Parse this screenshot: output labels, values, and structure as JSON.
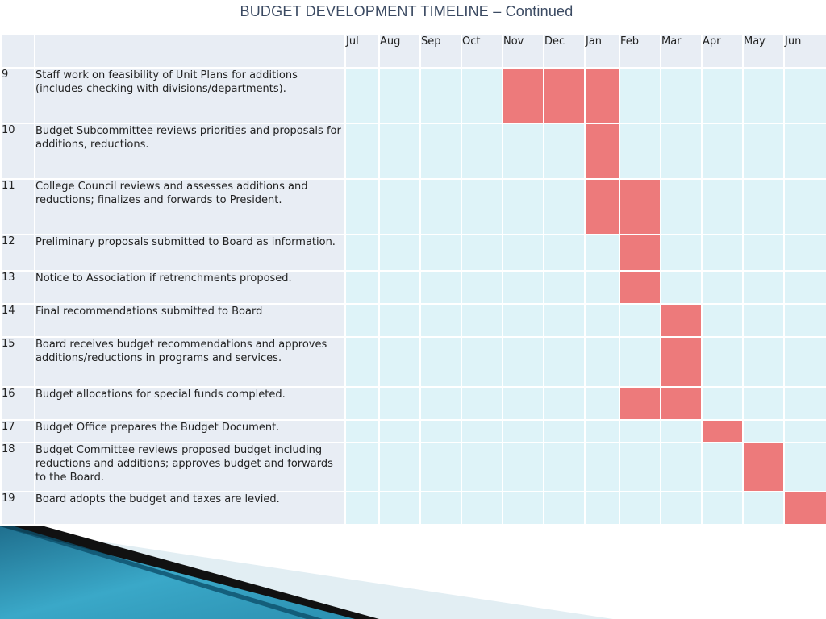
{
  "title": "BUDGET DEVELOPMENT TIMELINE – Continued",
  "months": [
    "Jul",
    "Aug",
    "Sep",
    "Oct",
    "Nov",
    "Dec",
    "Jan",
    "Feb",
    "Mar",
    "Apr",
    "May",
    "Jun"
  ],
  "rows": [
    {
      "num": "9",
      "task": "Staff work on feasibility of Unit Plans for additions (includes checking with divisions/departments).",
      "active": [
        "Nov",
        "Dec",
        "Jan"
      ]
    },
    {
      "num": "10",
      "task": "Budget Subcommittee reviews priorities and proposals for additions, reductions.",
      "active": [
        "Jan"
      ]
    },
    {
      "num": "11",
      "task": "College Council reviews and assesses additions and reductions; finalizes and forwards to President.",
      "active": [
        "Jan",
        "Feb"
      ]
    },
    {
      "num": "12",
      "task": "Preliminary proposals submitted to Board as information.",
      "active": [
        "Feb"
      ]
    },
    {
      "num": "13",
      "task": "Notice to Association if retrenchments proposed.",
      "active": [
        "Feb"
      ]
    },
    {
      "num": "14",
      "task": "Final recommendations submitted to Board",
      "active": [
        "Mar"
      ]
    },
    {
      "num": "15",
      "task": "Board receives budget recommendations and approves additions/reductions in programs and services.",
      "active": [
        "Mar"
      ]
    },
    {
      "num": "16",
      "task": "Budget allocations for special funds completed.",
      "active": [
        "Feb",
        "Mar"
      ]
    },
    {
      "num": "17",
      "task": "Budget Office prepares the Budget Document.",
      "active": [
        "Apr"
      ]
    },
    {
      "num": "18",
      "task": "Budget Committee reviews proposed budget including reductions and additions; approves budget and forwards to the Board.",
      "active": [
        "May"
      ]
    },
    {
      "num": "19",
      "task": "Board adopts the budget and taxes are levied.",
      "active": [
        "Jun"
      ]
    }
  ],
  "colors": {
    "header_bg": "#e8edf4",
    "cell_bg": "#def3f8",
    "active_bg": "#ed7a7b",
    "title_color": "#3b4a62"
  }
}
